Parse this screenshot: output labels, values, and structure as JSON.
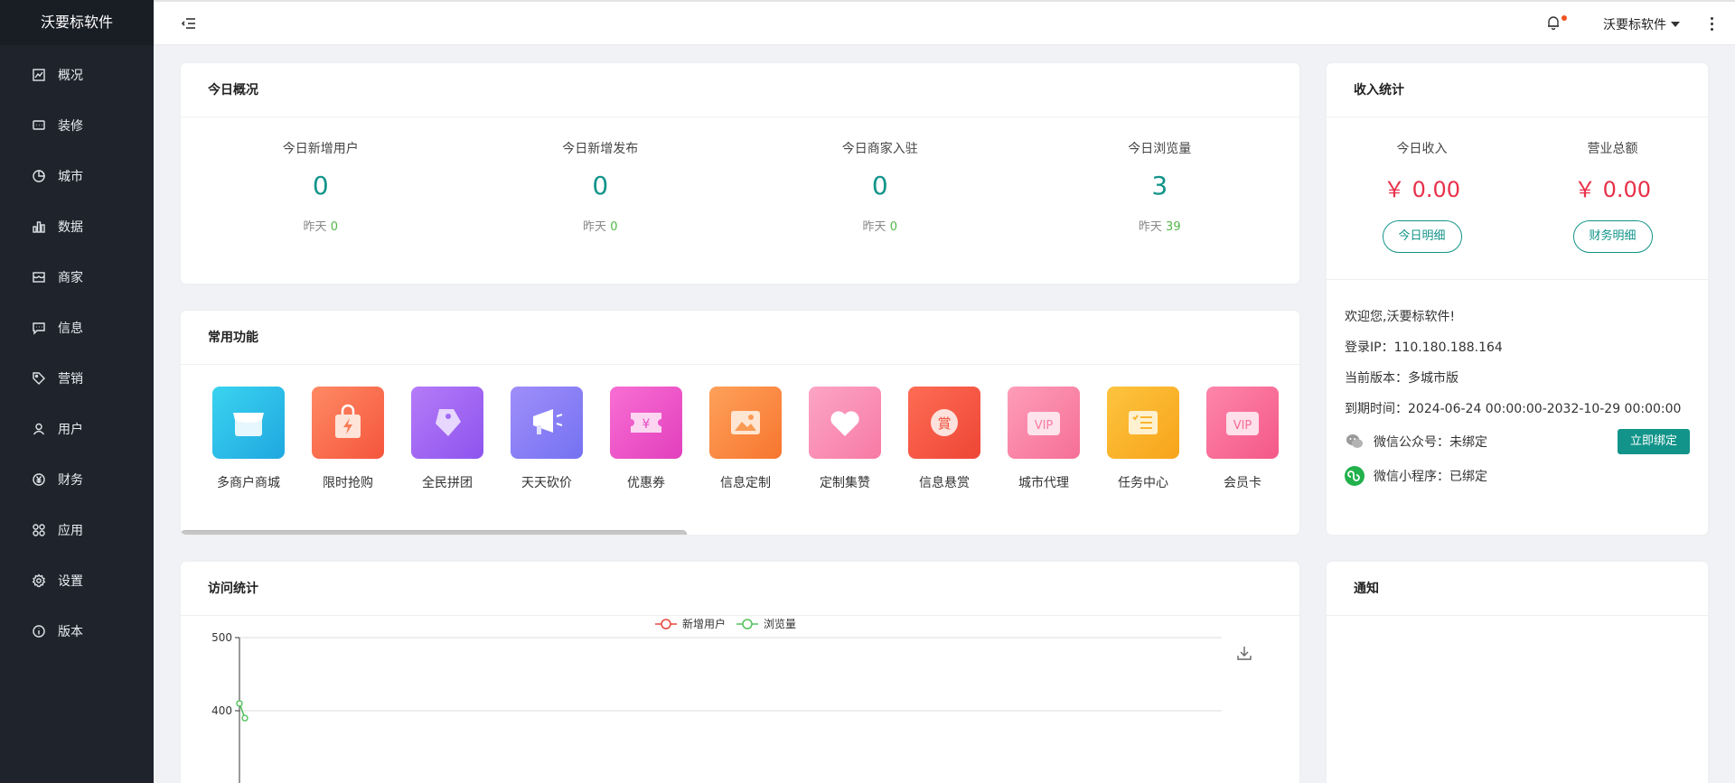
{
  "sidebar": {
    "brand": "沃要标软件",
    "items": [
      {
        "label": "概况",
        "icon": "overview-icon"
      },
      {
        "label": "装修",
        "icon": "decor-icon"
      },
      {
        "label": "城市",
        "icon": "city-icon"
      },
      {
        "label": "数据",
        "icon": "data-icon"
      },
      {
        "label": "商家",
        "icon": "merchant-icon"
      },
      {
        "label": "信息",
        "icon": "message-icon"
      },
      {
        "label": "营销",
        "icon": "tag-icon"
      },
      {
        "label": "用户",
        "icon": "user-icon"
      },
      {
        "label": "财务",
        "icon": "yen-icon"
      },
      {
        "label": "应用",
        "icon": "apps-icon"
      },
      {
        "label": "设置",
        "icon": "gear-icon"
      },
      {
        "label": "版本",
        "icon": "info-icon"
      }
    ]
  },
  "header": {
    "user_name": "沃要标软件",
    "notice_color": "#f0521e"
  },
  "today": {
    "title": "今日概况",
    "stats": [
      {
        "label": "今日新增用户",
        "value": "0",
        "yesterday_label": "昨天",
        "yesterday": "0"
      },
      {
        "label": "今日新增发布",
        "value": "0",
        "yesterday_label": "昨天",
        "yesterday": "0"
      },
      {
        "label": "今日商家入驻",
        "value": "0",
        "yesterday_label": "昨天",
        "yesterday": "0"
      },
      {
        "label": "今日浏览量",
        "value": "3",
        "yesterday_label": "昨天",
        "yesterday": "39"
      }
    ]
  },
  "functions": {
    "title": "常用功能",
    "items": [
      {
        "label": "多商户商城",
        "color": "#2ec4e8"
      },
      {
        "label": "限时抢购",
        "color": "#fb7452"
      },
      {
        "label": "全民拼团",
        "color": "#a56cf6"
      },
      {
        "label": "天天砍价",
        "color": "#8e84f7"
      },
      {
        "label": "优惠券",
        "color": "#f15ac8"
      },
      {
        "label": "信息定制",
        "color": "#fb8f46"
      },
      {
        "label": "定制集赞",
        "color": "#fb8fb6"
      },
      {
        "label": "信息悬赏",
        "color": "#fb5b4b"
      },
      {
        "label": "城市代理",
        "color": "#fb83a6"
      },
      {
        "label": "任务中心",
        "color": "#fbb52b"
      },
      {
        "label": "会员卡",
        "color": "#fb7199"
      },
      {
        "label": "",
        "color": "#5b9cf8"
      }
    ]
  },
  "income": {
    "title": "收入统计",
    "today_label": "今日收入",
    "today_value": "￥ 0.00",
    "today_button": "今日明细",
    "total_label": "营业总额",
    "total_value": "￥ 0.00",
    "total_button": "财务明细",
    "welcome": "欢迎您,沃要标软件!",
    "login_ip_label": "登录IP：",
    "login_ip": "110.180.188.164",
    "version_label": "当前版本：",
    "version": "多城市版",
    "expire_label": "到期时间：",
    "expire": "2024-06-24 00:00:00-2032-10-29 00:00:00",
    "wechat_mp_label": "微信公众号：",
    "wechat_mp_status": "未绑定",
    "bind_button": "立即绑定",
    "mini_label": "微信小程序：",
    "mini_status": "已绑定"
  },
  "visits": {
    "title": "访问统计"
  },
  "notice": {
    "title": "通知"
  },
  "chart_data": {
    "type": "line",
    "legend": [
      "新增用户",
      "浏览量"
    ],
    "legend_position": "top-center",
    "y_ticks": [
      400,
      500
    ],
    "grid": true,
    "series": [
      {
        "name": "新增用户",
        "color": "#e8463c",
        "values": []
      },
      {
        "name": "浏览量",
        "color": "#52c15b",
        "values": [
          410,
          390
        ]
      }
    ]
  }
}
